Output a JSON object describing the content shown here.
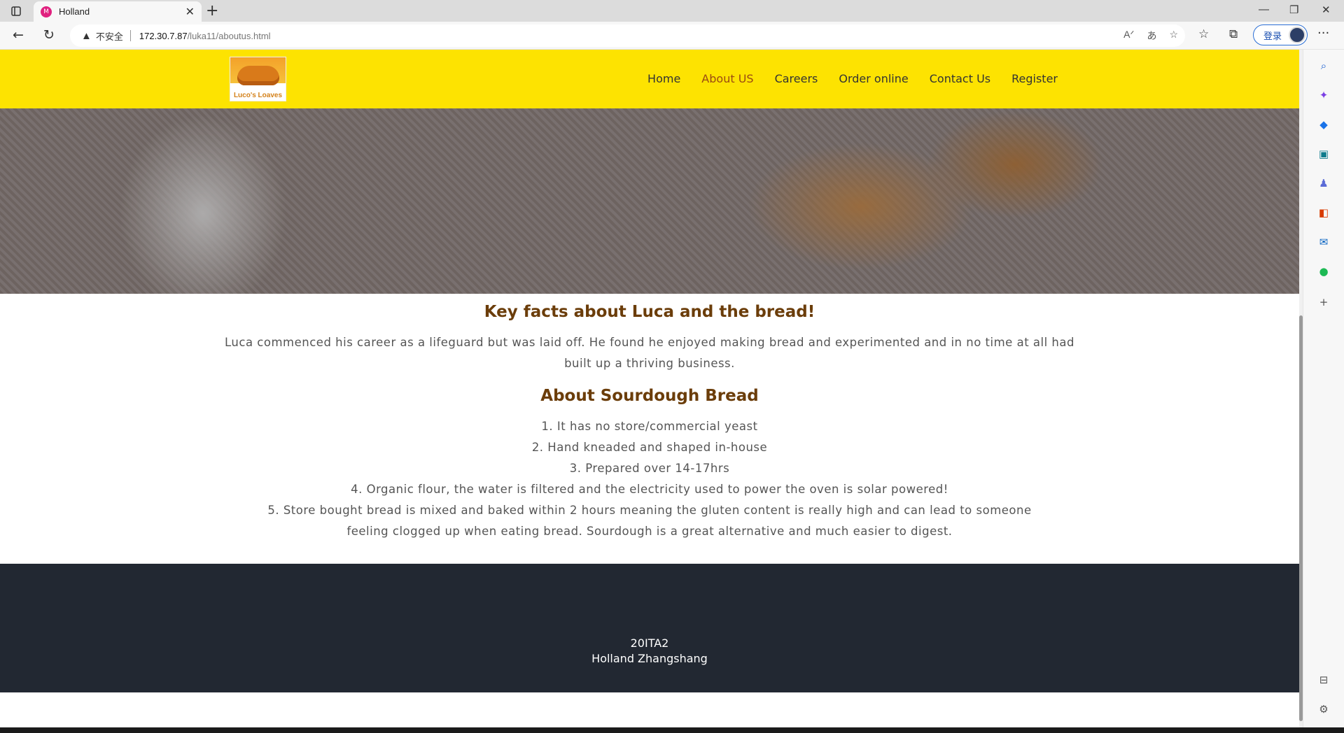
{
  "browser": {
    "tab_title": "Holland",
    "favicon_text": "M",
    "insecure_label": "不安全",
    "url_host": "172.30.7.87",
    "url_path": "/luka11/aboutus.html",
    "login_label": "登录"
  },
  "site": {
    "logo_text": "Luco's Loaves",
    "nav": [
      "Home",
      "About US",
      "Careers",
      "Order online",
      "Contact Us",
      "Register"
    ],
    "active_nav": "About US"
  },
  "content": {
    "heading1": "Key facts about Luca and the bread!",
    "intro": "Luca commenced his career as a lifeguard but was laid off. He found he enjoyed making bread and experimented and in no time at all had built up a thriving business.",
    "heading2": "About Sourdough Bread",
    "facts": [
      "1. It has no store/commercial yeast",
      "2. Hand kneaded and shaped in-house",
      "3. Prepared over 14-17hrs",
      "4. Organic flour, the water is filtered and the electricity used to power the oven is solar powered!",
      "5. Store bought bread is mixed and baked within 2 hours meaning the gluten content is really high and can lead to someone feeling clogged up when eating bread. Sourdough is a great alternative and much easier to digest."
    ]
  },
  "footer": {
    "line1": "20ITA2",
    "line2": "Holland Zhangshang"
  },
  "colors": {
    "header_bg": "#fde301",
    "heading": "#6b3d0a",
    "active_nav": "#9b4a12",
    "footer_bg": "#222832"
  }
}
